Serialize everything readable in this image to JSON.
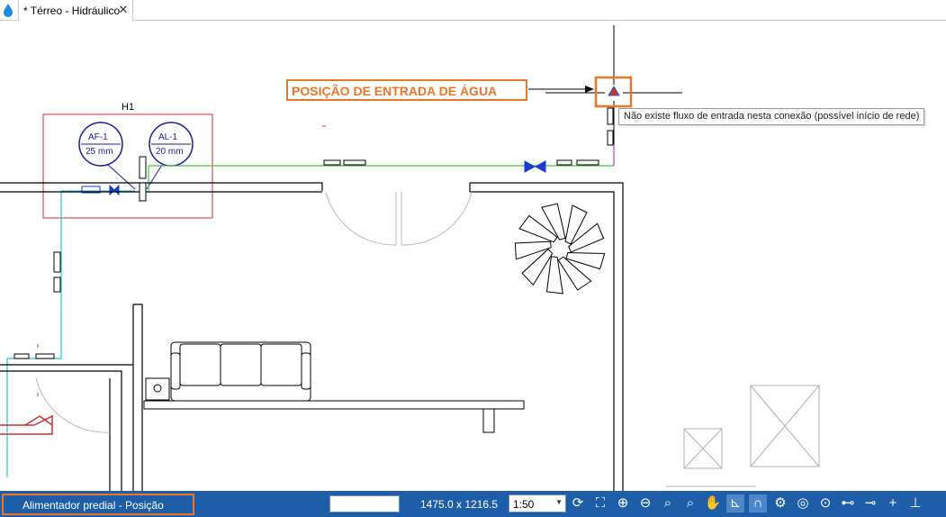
{
  "tab": {
    "title": "* Térreo - Hidráulico",
    "close_glyph": "✕"
  },
  "drawing": {
    "room_label": "H1",
    "tag_af": {
      "name": "AF-1",
      "diameter": "25 mm"
    },
    "tag_al": {
      "name": "AL-1",
      "diameter": "20 mm"
    },
    "callout": "POSIÇÃO DE ENTRADA DE ÁGUA",
    "tooltip": "Não existe fluxo de entrada nesta conexão (possível início de rede)"
  },
  "status": {
    "mode": "Alimentador predial - Posição",
    "coord_value": "",
    "dimensions": "1475.0 x 1216.5",
    "scale": "1:50",
    "tools": [
      {
        "name": "redraw-icon",
        "glyph": "⟳"
      },
      {
        "name": "zoom-extents-icon",
        "glyph": "⛶"
      },
      {
        "name": "zoom-in-icon",
        "glyph": "⊕"
      },
      {
        "name": "zoom-out-icon",
        "glyph": "⊖"
      },
      {
        "name": "zoom-window-icon",
        "glyph": "⌕"
      },
      {
        "name": "zoom-previous-icon",
        "glyph": "⌕"
      },
      {
        "name": "pan-hand-icon",
        "glyph": "✋"
      },
      {
        "name": "ortho-icon",
        "glyph": "⊾"
      },
      {
        "name": "snap-magnet-icon",
        "glyph": "∩"
      },
      {
        "name": "settings-gear-icon",
        "glyph": "⚙"
      },
      {
        "name": "circle-snap-icon",
        "glyph": "◎"
      },
      {
        "name": "center-snap-icon",
        "glyph": "⊙"
      },
      {
        "name": "endpoint-snap-icon",
        "glyph": "⊷"
      },
      {
        "name": "midpoint-snap-icon",
        "glyph": "⊸"
      },
      {
        "name": "intersection-snap-icon",
        "glyph": "+"
      },
      {
        "name": "perpendicular-snap-icon",
        "glyph": "⊥"
      }
    ],
    "colors": {
      "bar": "#1e5ea8",
      "highlight": "#ee7428"
    }
  }
}
